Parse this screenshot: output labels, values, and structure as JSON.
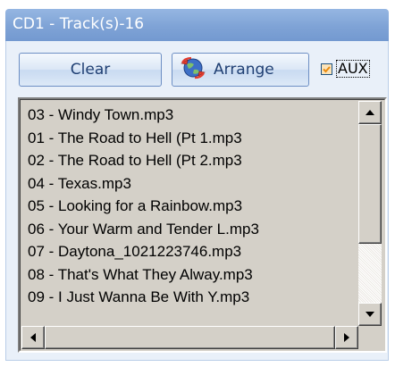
{
  "window": {
    "title": "CD1 - Track(s)-16"
  },
  "toolbar": {
    "clear_label": "Clear",
    "arrange_label": "Arrange",
    "arrange_icon": "globe-arrows-icon",
    "aux_label": "AUX",
    "aux_checked": true
  },
  "tracks": [
    "03 - Windy Town.mp3",
    "01 - The Road to Hell (Pt 1.mp3",
    "02 - The Road to Hell (Pt 2.mp3",
    "04 - Texas.mp3",
    "05 - Looking for a Rainbow.mp3",
    "06 - Your Warm and Tender L.mp3",
    "07 - Daytona_1021223746.mp3",
    "08 - That's What They Alway.mp3",
    "09 - I Just Wanna Be With Y.mp3"
  ],
  "colors": {
    "title_bar": "#7fa3d6",
    "panel_background": "#e9f0f9",
    "list_background": "#d4d0c8",
    "checkbox_accent": "#f0a030"
  }
}
